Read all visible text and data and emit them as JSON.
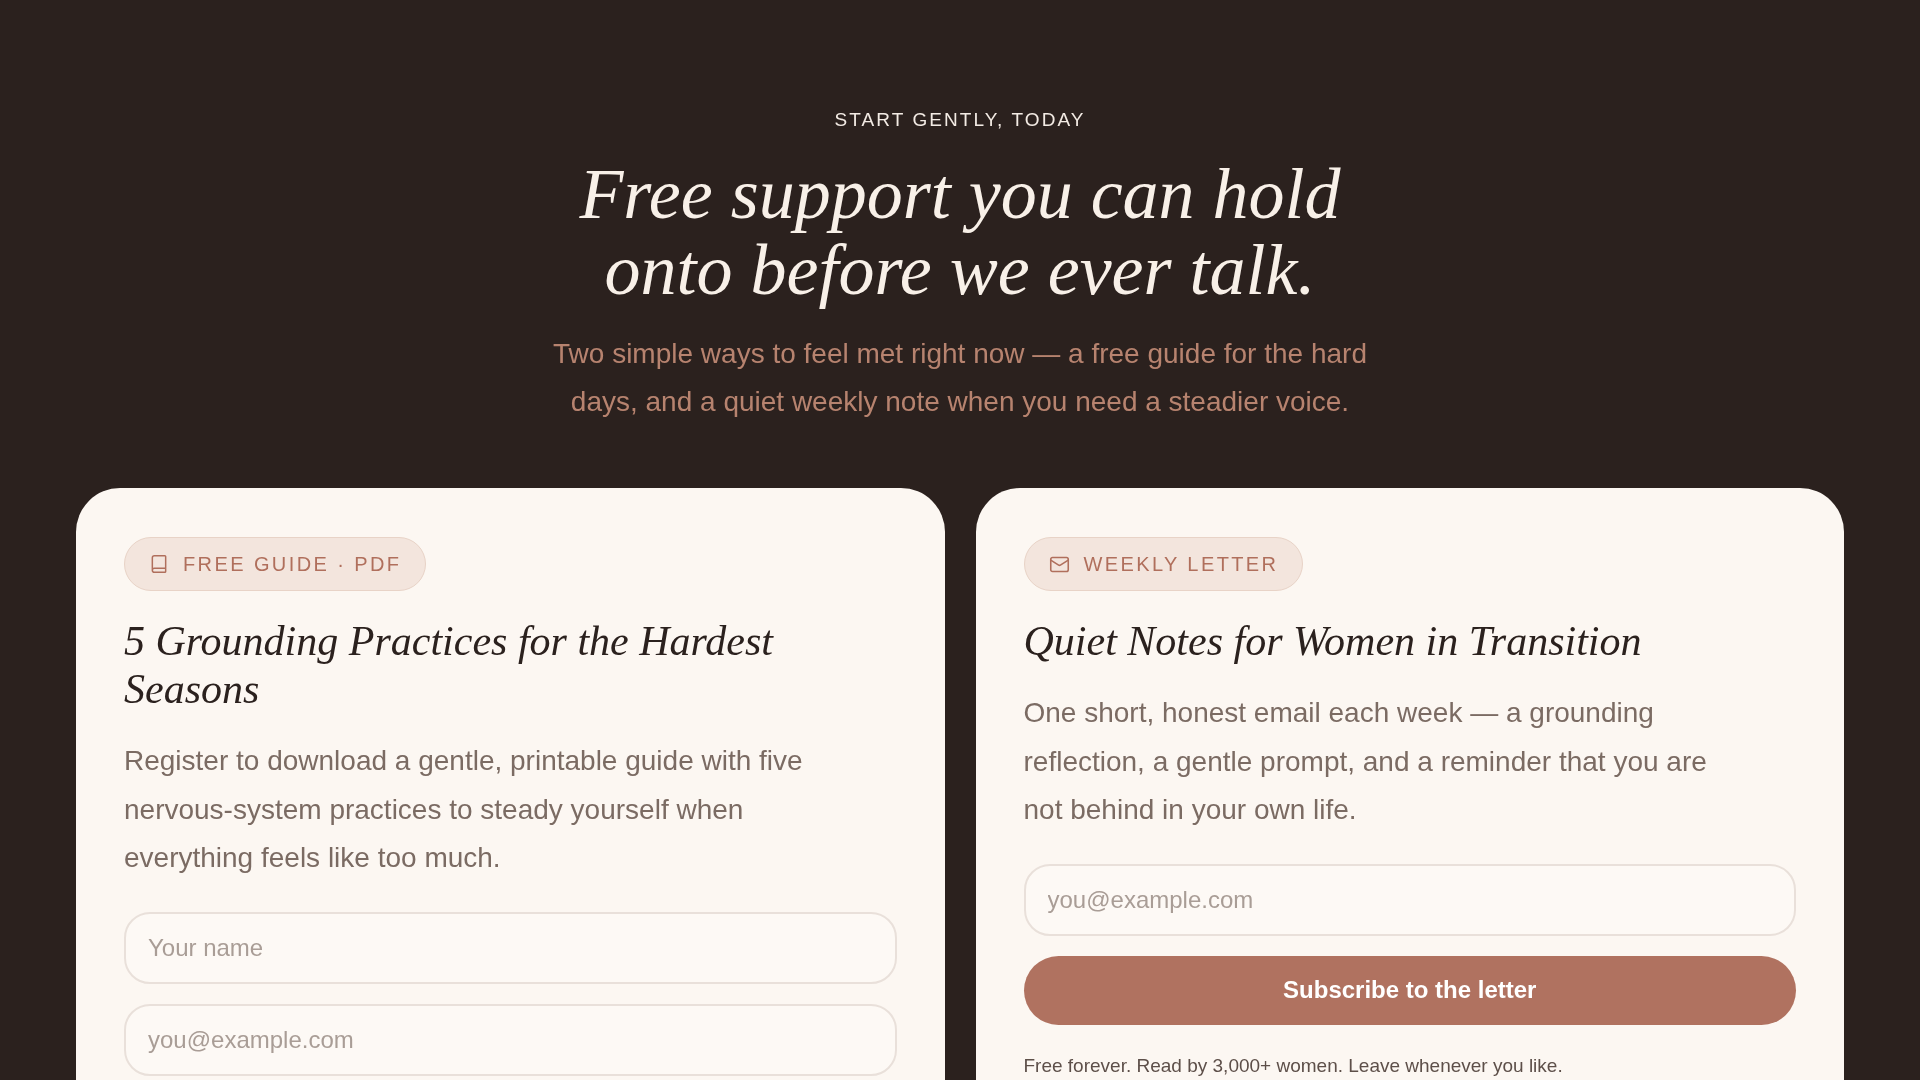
{
  "hero": {
    "eyebrow": "START GENTLY, TODAY",
    "title": "Free support you can hold onto before we ever talk.",
    "subtitle": "Two simple ways to feel met right now — a free guide for the hard days, and a quiet weekly note when you need a steadier voice."
  },
  "cards": [
    {
      "badge": {
        "kind": "book",
        "label": "FREE GUIDE · PDF"
      },
      "title": "5 Grounding Practices for the Hardest Seasons",
      "description": "Register to download a gentle, printable guide with five nervous-system practices to steady yourself when everything feels like too much.",
      "fields": [
        {
          "placeholder": "Your name"
        },
        {
          "placeholder": "you@example.com"
        }
      ]
    },
    {
      "badge": {
        "kind": "mail",
        "label": "WEEKLY LETTER"
      },
      "title": "Quiet Notes for Women in Transition",
      "description": "One short, honest email each week — a grounding reflection, a gentle prompt, and a reminder that you are not behind in your own life.",
      "fields": [
        {
          "placeholder": "you@example.com"
        }
      ],
      "button": "Subscribe to the letter",
      "note": "Free forever. Read by 3,000+ women. Leave whenever you like."
    }
  ]
}
